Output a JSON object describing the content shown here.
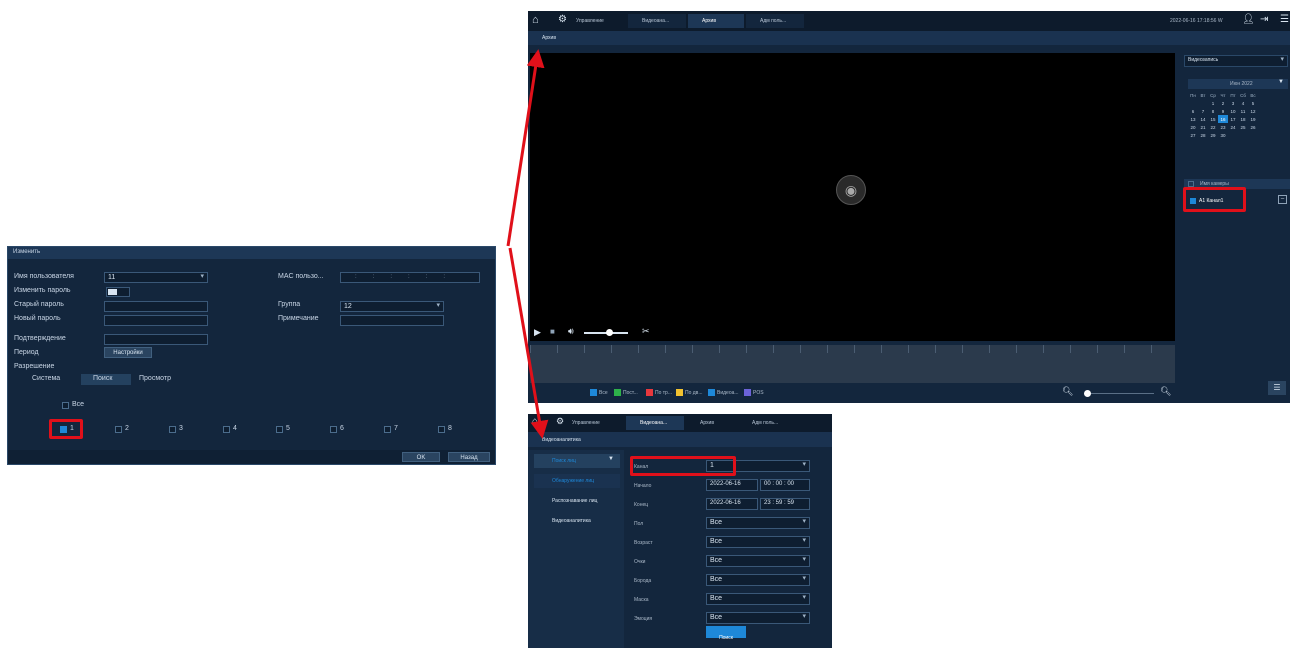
{
  "edit_dialog": {
    "title": "Изменить",
    "username_label": "Имя пользователя",
    "username_value": "11",
    "change_password_label": "Изменить пароль",
    "old_password_label": "Старый пароль",
    "new_password_label": "Новый пароль",
    "confirm_label": "Подтверждение",
    "period_label": "Период",
    "period_button": "Настройки",
    "mac_label": "MAC пользо...",
    "group_label": "Группа",
    "group_value": "12",
    "note_label": "Примечание",
    "permissions_label": "Разрешение",
    "tabs": [
      "Система",
      "Поиск",
      "Просмотр"
    ],
    "all_label": "Все",
    "channels": [
      "1",
      "2",
      "3",
      "4",
      "5",
      "6",
      "7",
      "8"
    ],
    "ok_label": "OK",
    "back_label": "Назад"
  },
  "archive_window": {
    "tabs": [
      "Управление",
      "Видеоана...",
      "Архив",
      "Адм поль..."
    ],
    "datetime": "2022-06-16 17:18:56 W",
    "page_title": "Архив",
    "side_dropdown": "Видеозапись",
    "calendar_month": "Июн 2022",
    "weekdays": [
      "Пн",
      "Вт",
      "Ср",
      "Чт",
      "Пт",
      "Сб",
      "Вс"
    ],
    "calendar_rows": [
      [
        "",
        "",
        "1",
        "2",
        "3",
        "4",
        "5"
      ],
      [
        "6",
        "7",
        "8",
        "9",
        "10",
        "11",
        "12"
      ],
      [
        "13",
        "14",
        "15",
        "16",
        "17",
        "18",
        "19"
      ],
      [
        "20",
        "21",
        "22",
        "23",
        "24",
        "25",
        "26"
      ],
      [
        "27",
        "28",
        "29",
        "30",
        "",
        "",
        ""
      ]
    ],
    "calendar_selected": "16",
    "channel_header": "Имя камеры",
    "channel_item": "A1 Канал1",
    "legend": [
      "Все",
      "Пост...",
      "По тр...",
      "По дв...",
      "Видеоа...",
      "POS"
    ],
    "legend_colors": [
      "#1e88d8",
      "#2eb24a",
      "#e8383d",
      "#f2c230",
      "#1e88d8",
      "#6c63d8"
    ]
  },
  "analytics_window": {
    "tabs": [
      "Управление",
      "Видеоана...",
      "Архив",
      "Адм поль..."
    ],
    "page_title": "Видеоаналитика",
    "menu_header": "Поиск лиц",
    "menu": [
      "Обнаружение лиц",
      "Распознавание лиц",
      "Видеоаналитика"
    ],
    "fields": [
      {
        "label": "Канал",
        "value": "1"
      },
      {
        "label": "Начало",
        "value": "2022-06-16",
        "time": "00 : 00 : 00"
      },
      {
        "label": "Конец",
        "value": "2022-06-16",
        "time": "23 : 59 : 59"
      },
      {
        "label": "Пол",
        "value": "Все"
      },
      {
        "label": "Возраст",
        "value": "Все"
      },
      {
        "label": "Очки",
        "value": "Все"
      },
      {
        "label": "Борода",
        "value": "Все"
      },
      {
        "label": "Маска",
        "value": "Все"
      },
      {
        "label": "Эмоция",
        "value": "Все"
      }
    ],
    "search_button": "Поиск"
  }
}
